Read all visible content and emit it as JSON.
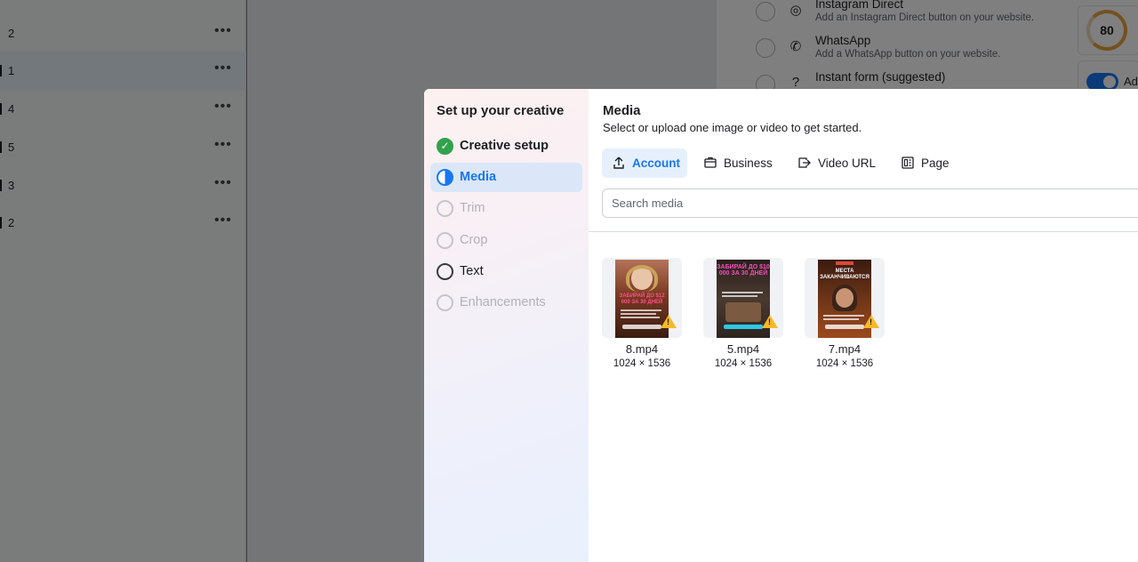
{
  "background": {
    "rows": [
      {
        "label": "2",
        "selected": false
      },
      {
        "label": "1",
        "selected": true
      },
      {
        "label": "4",
        "selected": false
      },
      {
        "label": "5",
        "selected": false
      },
      {
        "label": "3",
        "selected": false
      },
      {
        "label": "2",
        "selected": false
      }
    ],
    "row_menu": "•••",
    "destination_options": [
      {
        "title": "Instagram Direct",
        "subtitle": "Add an Instagram Direct button on your website.",
        "icon": "instagram-icon"
      },
      {
        "title": "WhatsApp",
        "subtitle": "Add a WhatsApp button on your website.",
        "icon": "whatsapp-icon"
      },
      {
        "title": "Instant form (suggested)",
        "subtitle": "",
        "icon": "question-icon"
      }
    ],
    "score": "80",
    "toggle_label": "Ad"
  },
  "dialog": {
    "sidebar_title": "Set up your creative",
    "steps": [
      {
        "label": "Creative setup",
        "state": "done"
      },
      {
        "label": "Media",
        "state": "active"
      },
      {
        "label": "Trim",
        "state": "disabled"
      },
      {
        "label": "Crop",
        "state": "disabled"
      },
      {
        "label": "Text",
        "state": "available"
      },
      {
        "label": "Enhancements",
        "state": "disabled"
      }
    ],
    "media": {
      "title": "Media",
      "subtitle": "Select or upload one image or video to get started.",
      "tabs": [
        {
          "label": "Account",
          "icon": "upload-icon",
          "active": true
        },
        {
          "label": "Business",
          "icon": "briefcase-icon",
          "active": false
        },
        {
          "label": "Video URL",
          "icon": "video-link-icon",
          "active": false
        },
        {
          "label": "Page",
          "icon": "page-icon",
          "active": false
        }
      ],
      "search_placeholder": "Search media",
      "items": [
        {
          "name": "8.mp4",
          "dimensions": "1024 × 1536",
          "headline": "ЗАБИРАЙ ДО $12 000 ЗА 30 ДНЕЙ",
          "accent": "#e3306c",
          "bg": "#7a3a22"
        },
        {
          "name": "5.mp4",
          "dimensions": "1024 × 1536",
          "headline": "ЗАБИРАЙ ДО $10 000 ЗА 30 ДНЕЙ",
          "accent": "#e84fc0",
          "bg": "#3b2a24"
        },
        {
          "name": "7.mp4",
          "dimensions": "1024 × 1536",
          "headline": "МЕСТА ЗАКАНЧИВАЮТСЯ",
          "accent": "#d94a33",
          "bg": "#6e3518"
        }
      ]
    }
  },
  "colors": {
    "accent": "#1877f2",
    "success": "#31a24c",
    "warning": "#f7b928"
  }
}
